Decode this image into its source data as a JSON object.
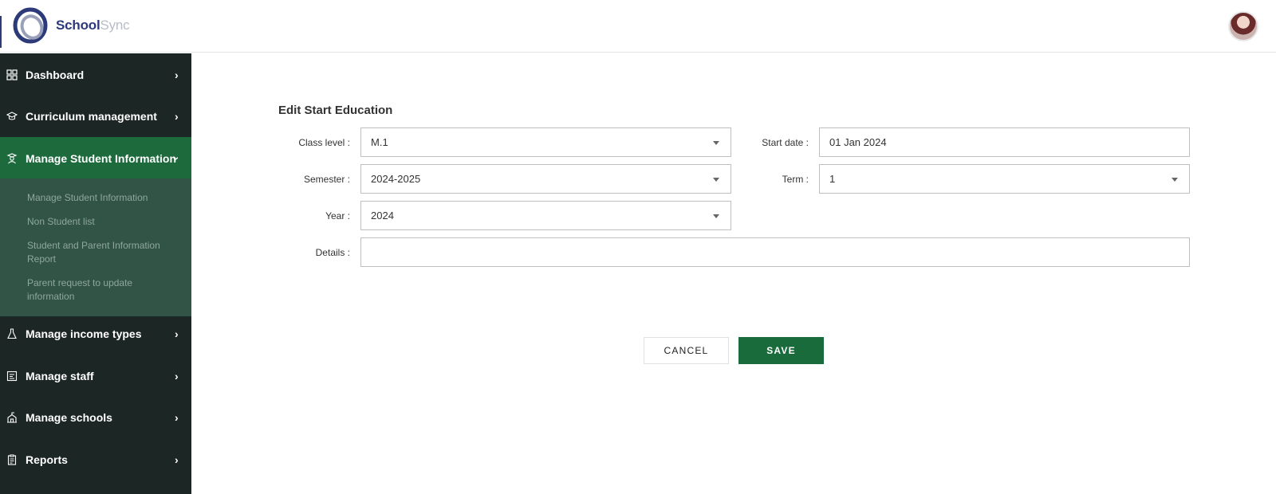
{
  "brand": {
    "name_part1": "School",
    "name_part2": "Sync",
    "primary_color": "#2d3a7a",
    "accent_color": "#1a6b3b"
  },
  "sidebar": {
    "items": [
      {
        "label": "Dashboard",
        "icon": "grid-icon"
      },
      {
        "label": "Curriculum management",
        "icon": "graduation-cap-icon"
      },
      {
        "label": "Manage Student Information",
        "icon": "student-icon",
        "expanded": true
      },
      {
        "label": "Manage income types",
        "icon": "flask-icon"
      },
      {
        "label": "Manage staff",
        "icon": "staff-icon"
      },
      {
        "label": "Manage schools",
        "icon": "school-icon"
      },
      {
        "label": "Reports",
        "icon": "clipboard-icon"
      }
    ],
    "submenu": [
      "Manage Student Information",
      "Non Student list",
      "Student and Parent Information Report",
      "Parent request to update information"
    ]
  },
  "form": {
    "title": "Edit Start Education",
    "class_level": {
      "label": "Class level :",
      "value": "M.1"
    },
    "start_date": {
      "label": "Start date :",
      "value": "01 Jan 2024"
    },
    "semester": {
      "label": "Semester :",
      "value": "2024-2025"
    },
    "term": {
      "label": "Term :",
      "value": "1"
    },
    "year": {
      "label": "Year :",
      "value": "2024"
    },
    "details": {
      "label": "Details :",
      "value": ""
    }
  },
  "actions": {
    "cancel": "CANCEL",
    "save": "SAVE"
  }
}
